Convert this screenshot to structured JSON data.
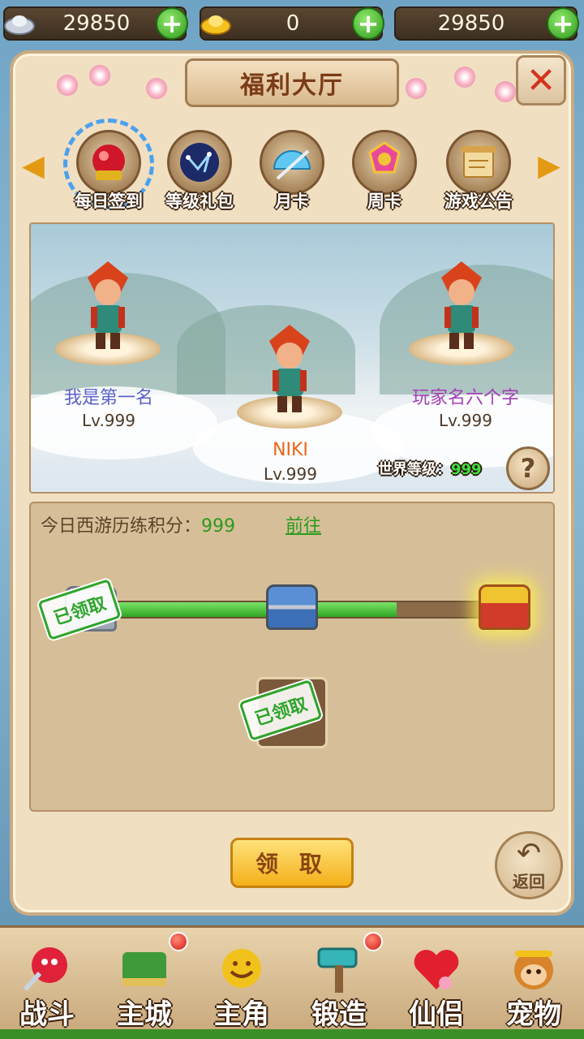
{
  "currency": [
    {
      "icon": "silver-ingot-icon",
      "amount": "29850"
    },
    {
      "icon": "gold-ingot-icon",
      "amount": "0"
    },
    {
      "icon": "",
      "amount": "29850"
    }
  ],
  "panel": {
    "title": "福利大厅"
  },
  "tabs": [
    {
      "label": "每日签到",
      "icon": "red-orb-icon",
      "active": true
    },
    {
      "label": "等级礼包",
      "icon": "constellation-icon"
    },
    {
      "label": "月卡",
      "icon": "fan-sword-icon"
    },
    {
      "label": "周卡",
      "icon": "medal-icon"
    },
    {
      "label": "游戏公告",
      "icon": "scroll-icon"
    }
  ],
  "ranking": [
    {
      "name": "我是第一名",
      "level": "Lv.999",
      "name_color": "#5b62c9"
    },
    {
      "name": "NIKI",
      "level": "Lv.999",
      "name_color": "#e8651a"
    },
    {
      "name": "玩家名六个字",
      "level": "Lv.999",
      "name_color": "#a43fb5"
    }
  ],
  "world_level": {
    "label": "世界等级：",
    "value": "999"
  },
  "progress": {
    "label": "今日西游历练积分：",
    "value": "999",
    "goto": "前往",
    "fill_fraction": 0.78,
    "stamp_text": "已领取"
  },
  "actions": {
    "claim": "领 取",
    "back": "返回"
  },
  "nav": [
    {
      "label": "战斗",
      "icon": "warrior-icon",
      "badge": false
    },
    {
      "label": "主城",
      "icon": "city-icon",
      "badge": true
    },
    {
      "label": "主角",
      "icon": "hero-face-icon",
      "badge": false
    },
    {
      "label": "锻造",
      "icon": "hammer-icon",
      "badge": true
    },
    {
      "label": "仙侣",
      "icon": "heart-icon",
      "badge": false
    },
    {
      "label": "宠物",
      "icon": "monkey-icon",
      "badge": false
    }
  ]
}
